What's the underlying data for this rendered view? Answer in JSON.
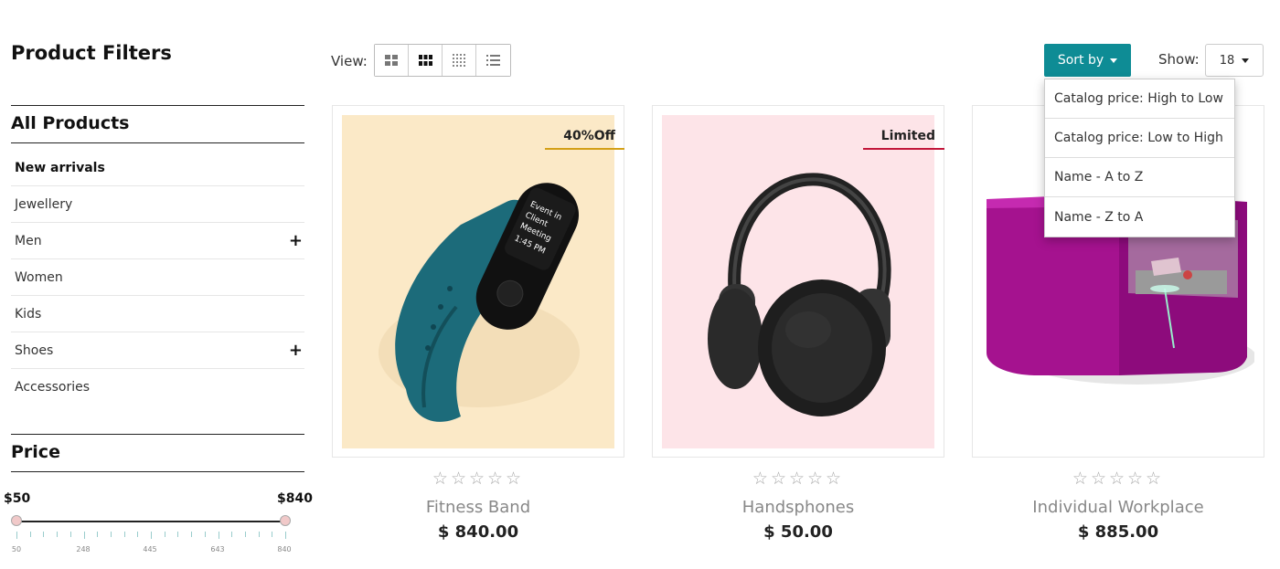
{
  "sidebar": {
    "title": "Product Filters",
    "all_products": "All Products",
    "categories": [
      {
        "label": "New arrivals",
        "expandable": false
      },
      {
        "label": "Jewellery",
        "expandable": false
      },
      {
        "label": "Men",
        "expandable": true
      },
      {
        "label": "Women",
        "expandable": false
      },
      {
        "label": "Kids",
        "expandable": false
      },
      {
        "label": "Shoes",
        "expandable": true
      },
      {
        "label": "Accessories",
        "expandable": false
      }
    ],
    "price": {
      "title": "Price",
      "min_label": "$50",
      "max_label": "$840",
      "ticks": [
        "50",
        "248",
        "445",
        "643",
        "840"
      ]
    }
  },
  "toolbar": {
    "view_label": "View:",
    "sort_label": "Sort by",
    "show_label": "Show:",
    "show_value": "18",
    "accent": "#0e8c95"
  },
  "sort_options": [
    "Catalog price: High to Low",
    "Catalog price: Low to High",
    "Name - A to Z",
    "Name - Z to A"
  ],
  "products": [
    {
      "name": "Fitness Band",
      "price": "$ 840.00",
      "badge": "40%Off",
      "stars": "☆☆☆☆☆",
      "bg": "#fbe9c7"
    },
    {
      "name": "Handsphones",
      "price": "$ 50.00",
      "badge": "Limited",
      "stars": "☆☆☆☆☆",
      "bg": "#fde4e8"
    },
    {
      "name": "Individual Workplace",
      "price": "$ 885.00",
      "badge": "",
      "stars": "☆☆☆☆☆",
      "bg": "#ffffff"
    }
  ]
}
